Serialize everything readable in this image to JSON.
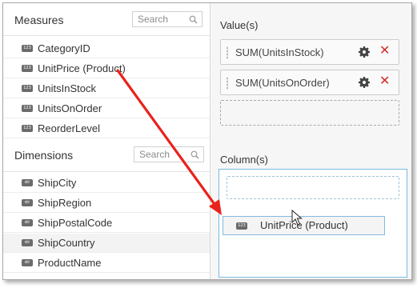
{
  "measures": {
    "title": "Measures",
    "search_placeholder": "Search",
    "items": [
      {
        "label": "CategoryID",
        "badge": "123"
      },
      {
        "label": "UnitPrice (Product)",
        "badge": "123"
      },
      {
        "label": "UnitsInStock",
        "badge": "123"
      },
      {
        "label": "UnitsOnOrder",
        "badge": "123"
      },
      {
        "label": "ReorderLevel",
        "badge": "123"
      }
    ]
  },
  "dimensions": {
    "title": "Dimensions",
    "search_placeholder": "Search",
    "items": [
      {
        "label": "ShipCity",
        "badge": "str"
      },
      {
        "label": "ShipRegion",
        "badge": "str"
      },
      {
        "label": "ShipPostalCode",
        "badge": "str"
      },
      {
        "label": "ShipCountry",
        "badge": "str"
      },
      {
        "label": "ProductName",
        "badge": "str"
      }
    ]
  },
  "values": {
    "title": "Value(s)",
    "items": [
      {
        "label": "SUM(UnitsInStock)",
        "remove": "✕"
      },
      {
        "label": "SUM(UnitsOnOrder)",
        "remove": "✕"
      }
    ]
  },
  "columns": {
    "title": "Column(s)",
    "dragging": {
      "label": "UnitPrice (Product)",
      "badge": "123"
    }
  },
  "colors": {
    "arrow": "#e8231b",
    "remove": "#d32b2b",
    "drop_border": "#7bb9e3"
  },
  "icons": [
    "search-icon",
    "gear-icon",
    "close-icon",
    "mouse-cursor-icon",
    "drag-grip-icon"
  ]
}
